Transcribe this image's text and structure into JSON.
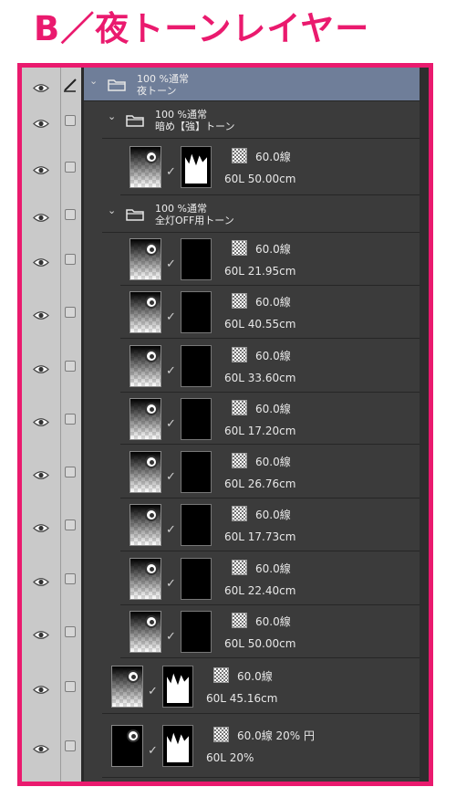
{
  "title": "B／夜トーンレイヤー",
  "layers": [
    {
      "kind": "folder",
      "level": 0,
      "line1": "100 %通常",
      "line2": "夜トーン",
      "selected": true,
      "edit": true
    },
    {
      "kind": "folder",
      "level": 1,
      "line1": "100 %通常",
      "line2": "暗め【強】トーン"
    },
    {
      "kind": "layer",
      "level": 2,
      "tone": "60.0線",
      "sub": "60L 50.00cm",
      "mask": "white"
    },
    {
      "kind": "folder",
      "level": 1,
      "line1": "100 %通常",
      "line2": "全灯OFF用トーン"
    },
    {
      "kind": "layer",
      "level": 2,
      "tone": "60.0線",
      "sub": "60L 21.95cm",
      "mask": "black"
    },
    {
      "kind": "layer",
      "level": 2,
      "tone": "60.0線",
      "sub": "60L 40.55cm",
      "mask": "black"
    },
    {
      "kind": "layer",
      "level": 2,
      "tone": "60.0線",
      "sub": "60L 33.60cm",
      "mask": "black"
    },
    {
      "kind": "layer",
      "level": 2,
      "tone": "60.0線",
      "sub": "60L 17.20cm",
      "mask": "black"
    },
    {
      "kind": "layer",
      "level": 2,
      "tone": "60.0線",
      "sub": "60L 26.76cm",
      "mask": "black"
    },
    {
      "kind": "layer",
      "level": 2,
      "tone": "60.0線",
      "sub": "60L 17.73cm",
      "mask": "black"
    },
    {
      "kind": "layer",
      "level": 2,
      "tone": "60.0線",
      "sub": "60L 22.40cm",
      "mask": "black"
    },
    {
      "kind": "layer",
      "level": 2,
      "tone": "60.0線",
      "sub": "60L 50.00cm",
      "mask": "black"
    },
    {
      "kind": "layer",
      "level": 1,
      "tone": "60.0線",
      "sub": "60L 45.16cm",
      "mask": "white"
    },
    {
      "kind": "layer",
      "level": 1,
      "tone": "60.0線 20% 円",
      "sub": "60L 20%",
      "mask": "white",
      "dark": true
    }
  ],
  "colors": {
    "accent": "#ea1a6e",
    "panel": "#3b3b3b",
    "selected": "#6f7e99",
    "gutter": "#c9c9c9"
  },
  "icons": {
    "visibility": "eye-icon",
    "lock": "lock-checkbox-icon",
    "expand": "chevron-down-icon",
    "folder": "folder-icon",
    "edit": "pencil-icon"
  }
}
